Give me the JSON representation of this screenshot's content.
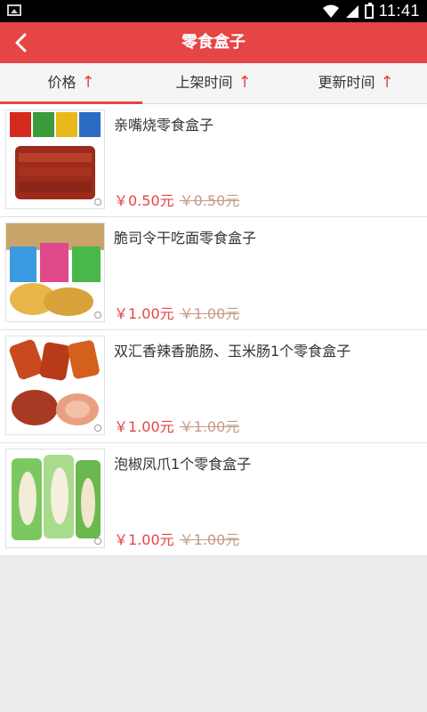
{
  "status_bar": {
    "time": "11:41"
  },
  "header": {
    "title": "零食盒子"
  },
  "tabs": [
    {
      "label": "价格",
      "arrow": "↑"
    },
    {
      "label": "上架时间",
      "arrow": "↑"
    },
    {
      "label": "更新时间",
      "arrow": "↑"
    }
  ],
  "products": [
    {
      "name": "亲嘴烧零食盒子",
      "price": "￥0.50元",
      "original_price": "￥0.50元"
    },
    {
      "name": "脆司令干吃面零食盒子",
      "price": "￥1.00元",
      "original_price": "￥1.00元"
    },
    {
      "name": "双汇香辣香脆肠、玉米肠1个零食盒子",
      "price": "￥1.00元",
      "original_price": "￥1.00元"
    },
    {
      "name": "泡椒凤爪1个零食盒子",
      "price": "￥1.00元",
      "original_price": "￥1.00元"
    }
  ],
  "colors": {
    "accent": "#e54545",
    "original_price": "#c49a86",
    "background": "#ececec"
  }
}
